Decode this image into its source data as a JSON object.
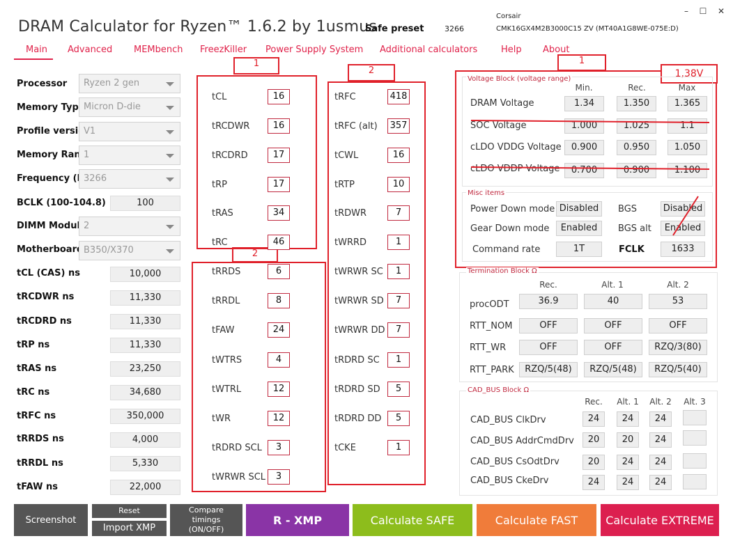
{
  "header": {
    "title": "DRAM Calculator for Ryzen™ 1.6.2 by 1usmus",
    "preset_label": "Safe preset",
    "preset_value": "3266",
    "module_line1": "Corsair",
    "module_line2": "CMK16GX4M2B3000C15  ZV (MT40A1G8WE-075E:D)"
  },
  "window": {
    "minimize": "–",
    "maximize": "☐",
    "close": "✕"
  },
  "tabs": [
    "Main",
    "Advanced",
    "MEMbench",
    "FreezKiller",
    "Power Supply System",
    "Additional calculators",
    "Help",
    "About"
  ],
  "left": {
    "dropdowns": [
      {
        "label": "Processor",
        "value": "Ryzen 2 gen"
      },
      {
        "label": "Memory Type",
        "value": "Micron D-die"
      },
      {
        "label": "Profile version",
        "value": "V1"
      },
      {
        "label": "Memory Rank",
        "value": "1"
      },
      {
        "label": "Frequency (MT/s)",
        "value": "3266"
      },
      {
        "label": "BCLK (100-104.8)",
        "value": "100"
      },
      {
        "label": "DIMM Modules",
        "value": "2"
      },
      {
        "label": "Motherboard",
        "value": "B350/X370"
      }
    ],
    "ns": [
      {
        "label": "tCL (CAS) ns",
        "value": "10,000"
      },
      {
        "label": "tRCDWR ns",
        "value": "11,330"
      },
      {
        "label": "tRCDRD ns",
        "value": "11,330"
      },
      {
        "label": "tRP ns",
        "value": "11,330"
      },
      {
        "label": "tRAS ns",
        "value": "23,250"
      },
      {
        "label": "tRC ns",
        "value": "34,680"
      },
      {
        "label": "tRFC ns",
        "value": "350,000"
      },
      {
        "label": "tRRDS ns",
        "value": "4,000"
      },
      {
        "label": "tRRDL ns",
        "value": "5,330"
      },
      {
        "label": "tFAW ns",
        "value": "22,000"
      }
    ]
  },
  "timings_a": [
    {
      "label": "tCL",
      "value": "16"
    },
    {
      "label": "tRCDWR",
      "value": "16"
    },
    {
      "label": "tRCDRD",
      "value": "17"
    },
    {
      "label": "tRP",
      "value": "17"
    },
    {
      "label": "tRAS",
      "value": "34"
    },
    {
      "label": "tRC",
      "value": "46"
    },
    {
      "label": "tRRDS",
      "value": "6"
    },
    {
      "label": "tRRDL",
      "value": "8"
    },
    {
      "label": "tFAW",
      "value": "24"
    },
    {
      "label": "tWTRS",
      "value": "4"
    },
    {
      "label": "tWTRL",
      "value": "12"
    },
    {
      "label": "tWR",
      "value": "12"
    },
    {
      "label": "tRDRD SCL",
      "value": "3"
    },
    {
      "label": "tWRWR SCL",
      "value": "3"
    }
  ],
  "timings_b": [
    {
      "label": "tRFC",
      "value": "418"
    },
    {
      "label": "tRFC (alt)",
      "value": "357"
    },
    {
      "label": "tCWL",
      "value": "16"
    },
    {
      "label": "tRTP",
      "value": "10"
    },
    {
      "label": "tRDWR",
      "value": "7"
    },
    {
      "label": "tWRRD",
      "value": "1"
    },
    {
      "label": "tWRWR SC",
      "value": "1"
    },
    {
      "label": "tWRWR SD",
      "value": "7"
    },
    {
      "label": "tWRWR DD",
      "value": "7"
    },
    {
      "label": "tRDRD SC",
      "value": "1"
    },
    {
      "label": "tRDRD SD",
      "value": "5"
    },
    {
      "label": "tRDRD DD",
      "value": "5"
    },
    {
      "label": "tCKE",
      "value": "1"
    }
  ],
  "annotations": {
    "tag1a": "1",
    "tag2a": "2",
    "tag1b": "1",
    "tag2b": "2",
    "voltage_note": "1,38V"
  },
  "voltage": {
    "title": "Voltage Block (voltage range)",
    "headers": [
      "Min.",
      "Rec.",
      "Max"
    ],
    "rows": [
      {
        "label": "DRAM Voltage",
        "values": [
          "1.34",
          "1.350",
          "1.365"
        ]
      },
      {
        "label": "SOC Voltage",
        "values": [
          "1.000",
          "1.025",
          "1.1"
        ]
      },
      {
        "label": "cLDO VDDG Voltage",
        "values": [
          "0.900",
          "0.950",
          "1.050"
        ]
      },
      {
        "label": "cLDO VDDP Voltage",
        "values": [
          "0.700",
          "0.900",
          "1.100"
        ]
      }
    ]
  },
  "misc": {
    "title": "Misc items",
    "power_down_label": "Power Down mode",
    "power_down": "Disabled",
    "bgs_label": "BGS",
    "bgs": "Disabled",
    "gear_down_label": "Gear Down mode",
    "gear_down": "Enabled",
    "bgs_alt_label": "BGS alt",
    "bgs_alt": "Enabled",
    "command_rate_label": "Command rate",
    "command_rate": "1T",
    "fclk_label": "FCLK",
    "fclk": "1633"
  },
  "termination": {
    "title": "Termination Block Ω",
    "headers": [
      "Rec.",
      "Alt. 1",
      "Alt. 2"
    ],
    "rows": [
      {
        "label": "procODT",
        "values": [
          "36.9",
          "40",
          "53"
        ]
      },
      {
        "label": "RTT_NOM",
        "values": [
          "OFF",
          "OFF",
          "OFF"
        ]
      },
      {
        "label": "RTT_WR",
        "values": [
          "OFF",
          "OFF",
          "RZQ/3(80)"
        ]
      },
      {
        "label": "RTT_PARK",
        "values": [
          "RZQ/5(48)",
          "RZQ/5(48)",
          "RZQ/5(40)"
        ]
      }
    ]
  },
  "cadbus": {
    "title": "CAD_BUS Block Ω",
    "headers": [
      "Rec.",
      "Alt. 1",
      "Alt. 2",
      "Alt. 3"
    ],
    "rows": [
      {
        "label": "CAD_BUS ClkDrv",
        "values": [
          "24",
          "24",
          "24",
          ""
        ]
      },
      {
        "label": "CAD_BUS AddrCmdDrv",
        "values": [
          "20",
          "20",
          "24",
          ""
        ]
      },
      {
        "label": "CAD_BUS CsOdtDrv",
        "values": [
          "20",
          "24",
          "24",
          ""
        ]
      },
      {
        "label": "CAD_BUS CkeDrv",
        "values": [
          "24",
          "24",
          "24",
          ""
        ]
      }
    ]
  },
  "buttons": {
    "screenshot": "Screenshot",
    "reset": "Reset",
    "import_xmp": "Import XMP",
    "compare": "Compare timings (ON/OFF)",
    "rxmp": "R - XMP",
    "safe": "Calculate SAFE",
    "fast": "Calculate FAST",
    "extreme": "Calculate EXTREME"
  },
  "colors": {
    "accent": "#e0224a",
    "xmp": "#8a34a6",
    "safe": "#8dbd1c",
    "fast": "#f07c3a",
    "extreme": "#dc1f4f",
    "annotation": "#e0202a"
  }
}
